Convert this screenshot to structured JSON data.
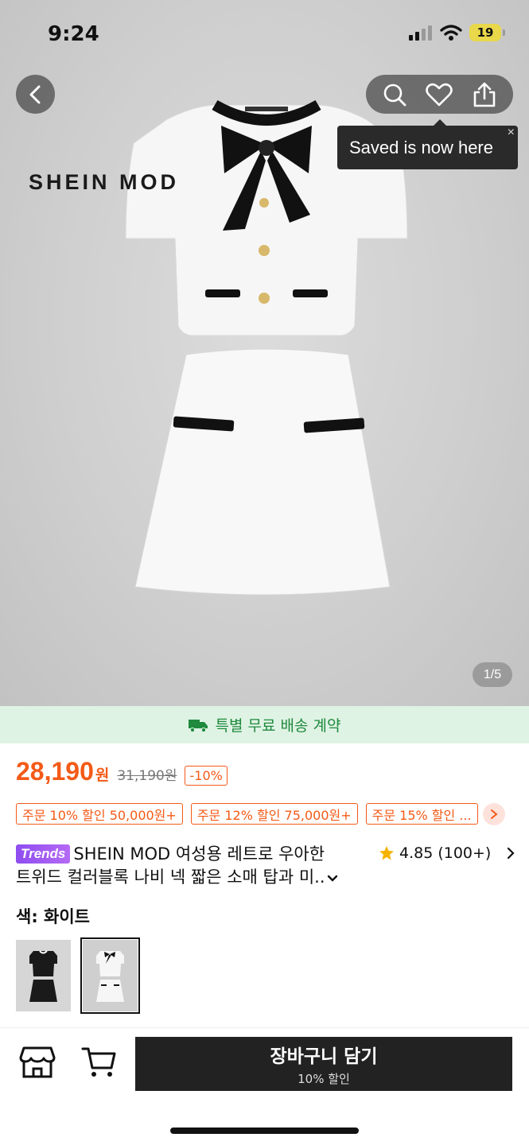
{
  "status_bar": {
    "time": "9:24",
    "battery": "19"
  },
  "hero": {
    "brand_logo": "SHEIN MOD",
    "tooltip_text": "Saved is now here",
    "tooltip_close": "×",
    "image_counter": "1/5"
  },
  "shipping_banner": {
    "text": "특별 무료 배송 계약"
  },
  "price": {
    "current": "28,190",
    "currency": "원",
    "original": "31,190원",
    "discount": "-10%",
    "accent_color": "#f35a17"
  },
  "coupons": [
    {
      "label": "주문 10% 할인 50,000원+"
    },
    {
      "label": "주문 12% 할인 75,000원+"
    },
    {
      "label": "주문 15% 할인 ..."
    }
  ],
  "product": {
    "tag": "Trends",
    "title_line1": "SHEIN MOD 여성용 레트로 우아한",
    "title_line2": "트위드 컬러블록 나비 넥 짧은 소매 탑과 미..",
    "rating": "4.85",
    "review_count": "(100+)"
  },
  "color": {
    "label": "색: 화이트"
  },
  "bottom_bar": {
    "add_to_cart": "장바구니 담기",
    "add_to_cart_sub": "10% 할인"
  }
}
